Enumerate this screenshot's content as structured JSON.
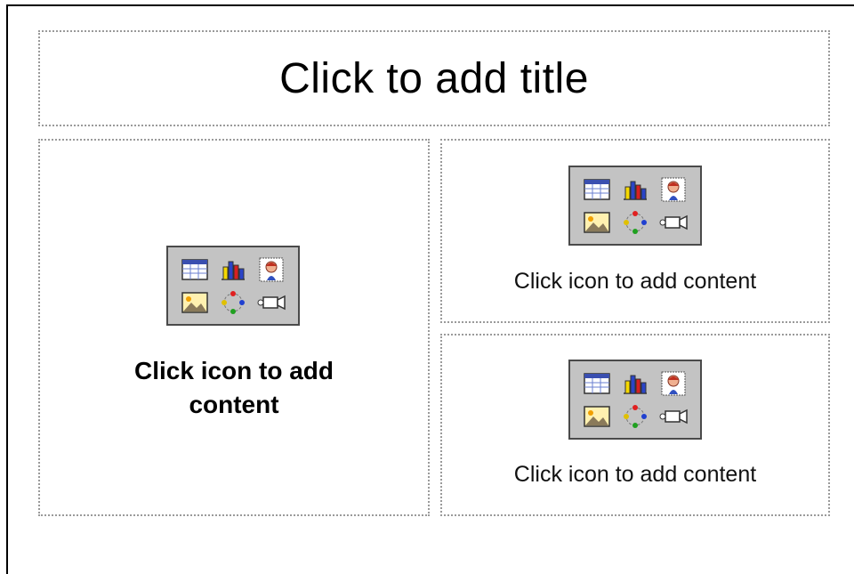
{
  "slide": {
    "title_placeholder": "Click to add title",
    "left_content": {
      "label": "Click icon to add content",
      "icons": [
        "table-icon",
        "chart-icon",
        "clip-art-icon",
        "picture-icon",
        "diagram-icon",
        "media-clip-icon"
      ]
    },
    "right_top_content": {
      "label": "Click icon to add content",
      "icons": [
        "table-icon",
        "chart-icon",
        "clip-art-icon",
        "picture-icon",
        "diagram-icon",
        "media-clip-icon"
      ]
    },
    "right_bottom_content": {
      "label": "Click icon to add content",
      "icons": [
        "table-icon",
        "chart-icon",
        "clip-art-icon",
        "picture-icon",
        "diagram-icon",
        "media-clip-icon"
      ]
    }
  },
  "colors": {
    "placeholder_border": "#9a9a9a",
    "palette_bg": "#c3c3c3",
    "palette_border": "#4a4a4a"
  }
}
